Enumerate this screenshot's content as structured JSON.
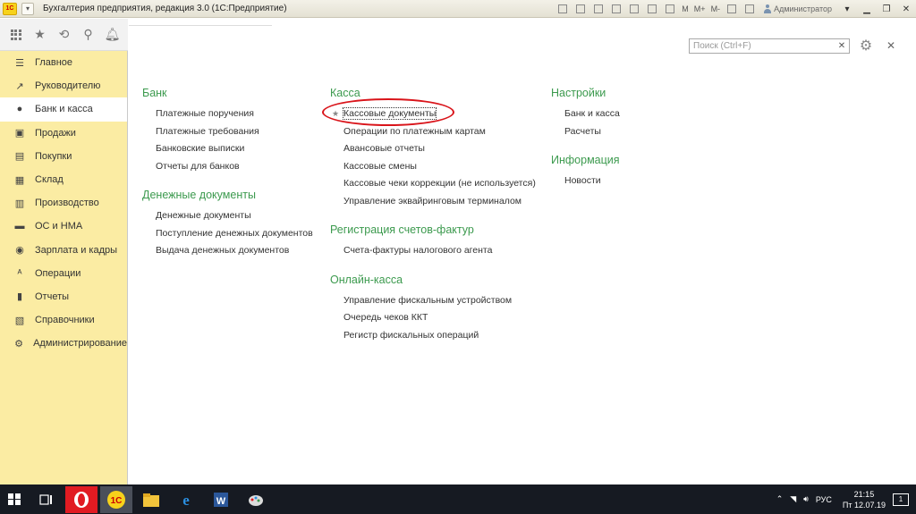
{
  "window": {
    "title": "Бухгалтерия предприятия, редакция 3.0  (1С:Предприятие)",
    "logo_text": "1С",
    "toolbar_labels": {
      "m": "M",
      "m_plus": "M+",
      "m_minus": "M-"
    },
    "user": "Администратор"
  },
  "sidebar": {
    "items": [
      {
        "label": "Главное",
        "icon": "menu-lines-icon"
      },
      {
        "label": "Руководителю",
        "icon": "chart-line-icon"
      },
      {
        "label": "Банк и касса",
        "icon": "coin-icon",
        "active": true
      },
      {
        "label": "Продажи",
        "icon": "cart-icon"
      },
      {
        "label": "Покупки",
        "icon": "basket-icon"
      },
      {
        "label": "Склад",
        "icon": "warehouse-icon"
      },
      {
        "label": "Производство",
        "icon": "factory-icon"
      },
      {
        "label": "ОС и НМА",
        "icon": "car-icon"
      },
      {
        "label": "Зарплата и кадры",
        "icon": "people-icon"
      },
      {
        "label": "Операции",
        "icon": "operations-icon"
      },
      {
        "label": "Отчеты",
        "icon": "bar-chart-icon"
      },
      {
        "label": "Справочники",
        "icon": "books-icon"
      },
      {
        "label": "Администрирование",
        "icon": "gear-icon"
      }
    ]
  },
  "search": {
    "placeholder": "Поиск (Ctrl+F)"
  },
  "columns": [
    {
      "groups": [
        {
          "title": "Банк",
          "links": [
            "Платежные поручения",
            "Платежные требования",
            "Банковские выписки",
            "Отчеты для банков"
          ]
        },
        {
          "title": "Денежные документы",
          "links": [
            "Денежные документы",
            "Поступление денежных документов",
            "Выдача денежных документов"
          ]
        }
      ]
    },
    {
      "groups": [
        {
          "title": "Касса",
          "links": [
            "Кассовые документы",
            "Операции по платежным картам",
            "Авансовые отчеты",
            "Кассовые смены",
            "Кассовые чеки коррекции (не используется)",
            "Управление эквайринговым терминалом"
          ]
        },
        {
          "title": "Регистрация счетов-фактур",
          "links": [
            "Счета-фактуры налогового агента"
          ]
        },
        {
          "title": "Онлайн-касса",
          "links": [
            "Управление фискальным устройством",
            "Очередь чеков ККТ",
            "Регистр фискальных операций"
          ]
        }
      ]
    },
    {
      "groups": [
        {
          "title": "Настройки",
          "links": [
            "Банк и касса",
            "Расчеты"
          ]
        },
        {
          "title": "Информация",
          "links": [
            "Новости"
          ]
        }
      ]
    }
  ],
  "taskbar": {
    "language": "РУС",
    "time": "21:15",
    "date": "Пт 12.07.19",
    "notifications": "1"
  },
  "colors": {
    "sidebar_bg": "#fbeca3",
    "group_title": "#3c9a4e",
    "highlight_oval": "#d9141a",
    "taskbar_bg": "#161a22"
  }
}
